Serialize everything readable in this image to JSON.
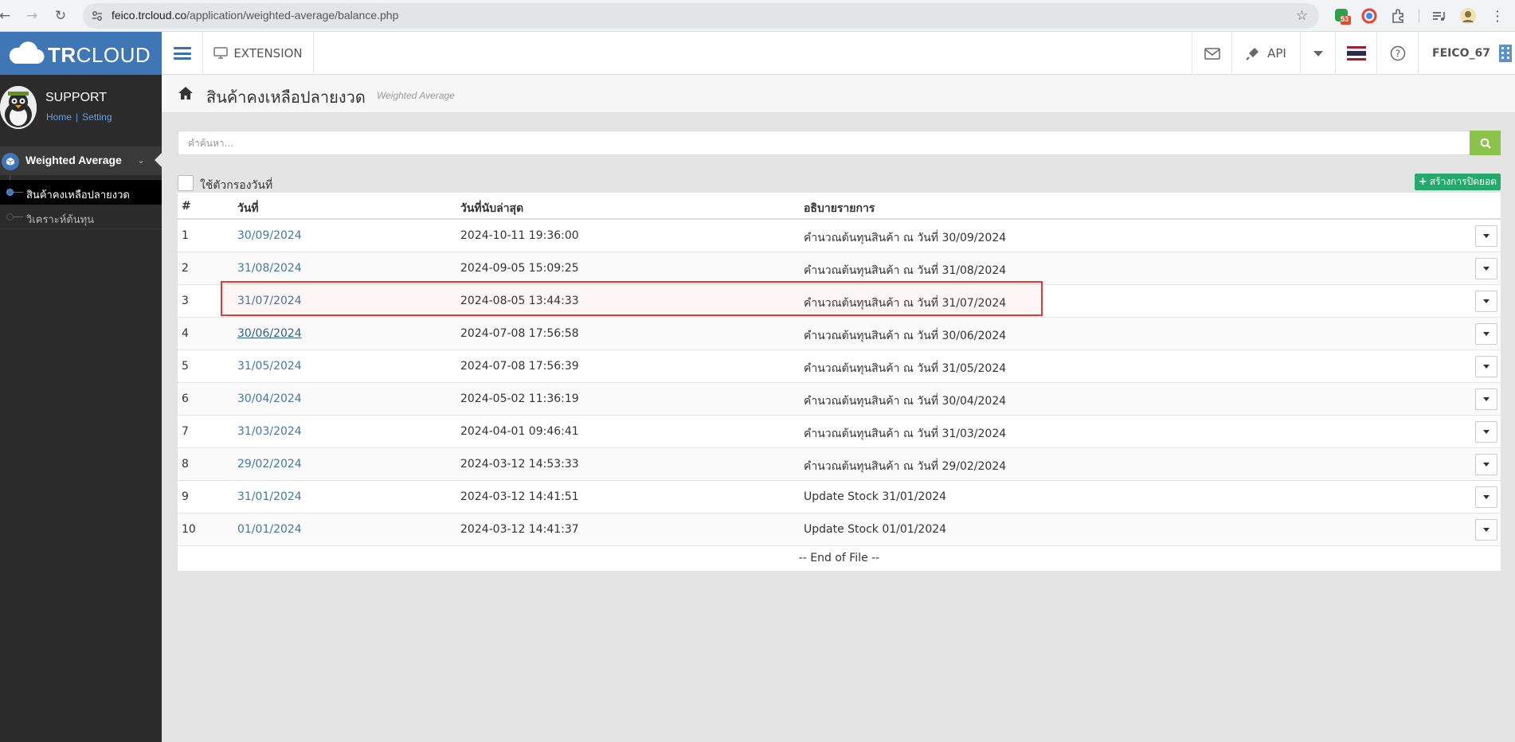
{
  "browser": {
    "url_host": "feico.trcloud.co",
    "url_path": "/application/weighted-average/balance.php",
    "extension_badge": "53"
  },
  "app": {
    "logo_bold": "TR",
    "logo_light": "CLOUD",
    "extension_label": "EXTENSION",
    "api_label": "API",
    "user_label": "FEICO_67"
  },
  "sidebar": {
    "profile_name": "SUPPORT",
    "link_home": "Home",
    "link_sep": "|",
    "link_setting": "Setting",
    "group_label": "Weighted Average",
    "items": [
      {
        "label": "สินค้าคงเหลือปลายงวด",
        "active": true
      },
      {
        "label": "วิเคราะห์ต้นทุน",
        "active": false
      }
    ]
  },
  "page": {
    "title": "สินค้าคงเหลือปลายงวด",
    "subtitle": "Weighted Average",
    "search_placeholder": "คำค้นหา...",
    "filter_label": "ใช้ตัวกรองวันที่",
    "create_label": "สร้างการปิดยอด",
    "create_plus": "+"
  },
  "table": {
    "headers": [
      "#",
      "วันที่",
      "วันที่นับล่าสุด",
      "อธิบายรายการ"
    ],
    "rows": [
      {
        "no": "1",
        "date": "30/09/2024",
        "counted": "2024-10-11 19:36:00",
        "desc": "คำนวณต้นทุนสินค้า ณ วันที่ 30/09/2024"
      },
      {
        "no": "2",
        "date": "31/08/2024",
        "counted": "2024-09-05 15:09:25",
        "desc": "คำนวณต้นทุนสินค้า ณ วันที่ 31/08/2024"
      },
      {
        "no": "3",
        "date": "31/07/2024",
        "counted": "2024-08-05 13:44:33",
        "desc": "คำนวณต้นทุนสินค้า ณ วันที่ 31/07/2024"
      },
      {
        "no": "4",
        "date": "30/06/2024",
        "counted": "2024-07-08 17:56:58",
        "desc": "คำนวณต้นทุนสินค้า ณ วันที่ 30/06/2024"
      },
      {
        "no": "5",
        "date": "31/05/2024",
        "counted": "2024-07-08 17:56:39",
        "desc": "คำนวณต้นทุนสินค้า ณ วันที่ 31/05/2024"
      },
      {
        "no": "6",
        "date": "30/04/2024",
        "counted": "2024-05-02 11:36:19",
        "desc": "คำนวณต้นทุนสินค้า ณ วันที่ 30/04/2024"
      },
      {
        "no": "7",
        "date": "31/03/2024",
        "counted": "2024-04-01 09:46:41",
        "desc": "คำนวณต้นทุนสินค้า ณ วันที่ 31/03/2024"
      },
      {
        "no": "8",
        "date": "29/02/2024",
        "counted": "2024-03-12 14:53:33",
        "desc": "คำนวณต้นทุนสินค้า ณ วันที่ 29/02/2024"
      },
      {
        "no": "9",
        "date": "31/01/2024",
        "counted": "2024-03-12 14:41:51",
        "desc": "Update Stock 31/01/2024"
      },
      {
        "no": "10",
        "date": "01/01/2024",
        "counted": "2024-03-12 14:41:37",
        "desc": "Update Stock 01/01/2024"
      }
    ],
    "end_label": "-- End of File --"
  },
  "colors": {
    "brand": "#3f76b6",
    "search_button": "#8bc34a",
    "create_button": "#26a96c",
    "highlight": "#e53935"
  }
}
